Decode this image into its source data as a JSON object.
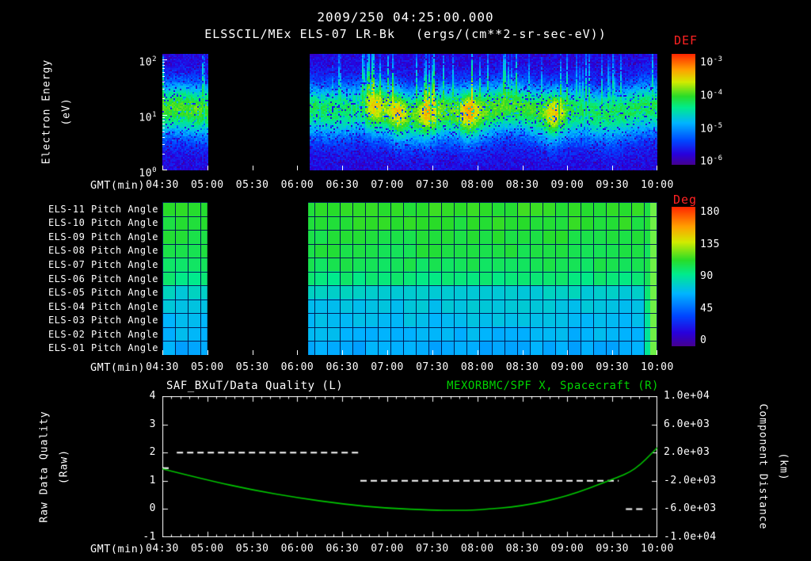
{
  "colors": {
    "background": "#000000",
    "text": "#ffffff",
    "label_red": "#ff2222",
    "series_green": "#00c800"
  },
  "header": {
    "timestamp": "2009/250 04:25:00.000",
    "instrument": "ELSSCIL/MEx ELS-07 LR-Bk",
    "units": "(ergs/(cm**2-sr-sec-eV))"
  },
  "time_axis": {
    "label": "GMT(min)",
    "interval_hours": 0.5,
    "ticks": [
      "04:30",
      "05:00",
      "05:30",
      "06:00",
      "06:30",
      "07:00",
      "07:30",
      "08:00",
      "08:30",
      "09:00",
      "09:30",
      "10:00"
    ]
  },
  "chart_data": [
    {
      "id": "electron-energy-spectrogram",
      "type": "heatmap",
      "ylabel": "Electron Energy",
      "ylabel_units": "(eV)",
      "yscale": "log",
      "ytick_labels": [
        "10^2",
        "10^1",
        "10^0"
      ],
      "energy_range_eV": [
        1,
        126
      ],
      "colorbar": {
        "label": "DEF",
        "tick_labels": [
          "10^-3",
          "10^-4",
          "10^-5",
          "10^-6"
        ],
        "units": "ergs/(cm**2-sr-sec-eV)",
        "scale": "log"
      },
      "time_gap_hours_from_start": [
        0.5,
        1.62
      ],
      "band_model": {
        "center_log10_eV": 1.1,
        "sigma_decades": 0.32,
        "peak_level": 0.5,
        "background_level": 0.11
      },
      "bright_patches_hours": [
        2.35,
        2.6,
        2.95,
        3.4,
        4.35
      ]
    },
    {
      "id": "pitch-angle-panels",
      "type": "heatmap",
      "rows": [
        {
          "label": "ELS-11 Pitch Angle",
          "mean_deg": 112
        },
        {
          "label": "ELS-10 Pitch Angle",
          "mean_deg": 110
        },
        {
          "label": "ELS-09 Pitch Angle",
          "mean_deg": 108
        },
        {
          "label": "ELS-08 Pitch Angle",
          "mean_deg": 106
        },
        {
          "label": "ELS-07 Pitch Angle",
          "mean_deg": 103
        },
        {
          "label": "ELS-06 Pitch Angle",
          "mean_deg": 97
        },
        {
          "label": "ELS-05 Pitch Angle",
          "mean_deg": 80
        },
        {
          "label": "ELS-04 Pitch Angle",
          "mean_deg": 75
        },
        {
          "label": "ELS-03 Pitch Angle",
          "mean_deg": 72
        },
        {
          "label": "ELS-02 Pitch Angle",
          "mean_deg": 69
        },
        {
          "label": "ELS-01 Pitch Angle",
          "mean_deg": 66
        }
      ],
      "colorbar": {
        "label": "Deg",
        "tick_labels": [
          "180",
          "135",
          "90",
          "45",
          "0"
        ],
        "range_deg": [
          0,
          180
        ]
      },
      "time_gap_hours_from_start": [
        0.5,
        1.62
      ],
      "right_edge_deg": 104
    },
    {
      "id": "quality-and-distance",
      "type": "line",
      "title_left": "SAF_BXuT/Data Quality (L)",
      "title_right": "MEXORBMC/SPF X, Spacecraft (R)",
      "left_axis": {
        "label": "Raw Data Quality",
        "units": "(Raw)",
        "tick_labels": [
          "4",
          "3",
          "2",
          "1",
          "0",
          "-1"
        ],
        "range": [
          -1,
          4
        ]
      },
      "right_axis": {
        "label": "Component Distance",
        "units": "(km)",
        "tick_labels": [
          "1.0e+04",
          "6.0e+03",
          "2.0e+03",
          "-2.0e+03",
          "-6.0e+03",
          "-1.0e+04"
        ],
        "range": [
          -10000,
          10000
        ]
      },
      "series": [
        {
          "name": "SAF_BXuT/Data Quality",
          "axis": "left",
          "color": "#ffffff",
          "style": "dashed",
          "segments": [
            {
              "t_hours": [
                0.0,
                0.1
              ],
              "y": 1.45
            },
            {
              "t_hours": [
                0.16,
                2.2
              ],
              "y": 2
            },
            {
              "t_hours": [
                2.2,
                5.07
              ],
              "y": 1
            },
            {
              "t_hours": [
                5.15,
                5.37
              ],
              "y": 0
            }
          ]
        },
        {
          "name": "MEXORBMC/SPF X Spacecraft",
          "axis": "right",
          "color": "#00c800",
          "style": "solid",
          "t_hours": [
            0,
            0.5,
            1,
            1.5,
            2,
            2.5,
            3,
            3.25,
            3.5,
            4,
            4.5,
            5,
            5.25,
            5.5
          ],
          "values_km": [
            -300,
            -1900,
            -3300,
            -4400,
            -5300,
            -5900,
            -6150,
            -6200,
            -6150,
            -5600,
            -4200,
            -1800,
            -500,
            2700
          ]
        }
      ]
    }
  ]
}
